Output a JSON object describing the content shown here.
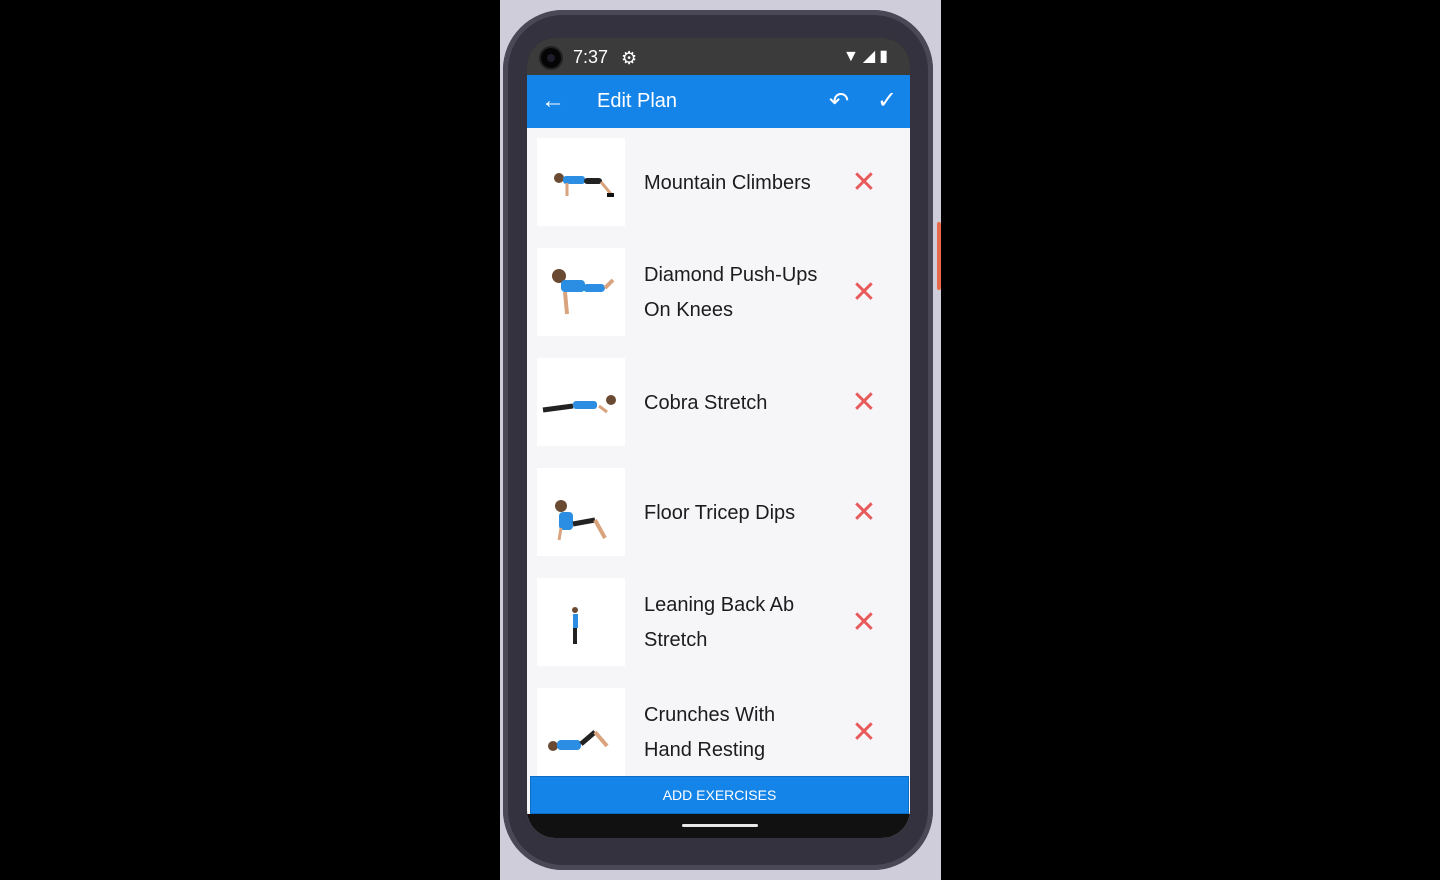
{
  "status_bar": {
    "time": "7:37",
    "settings_icon": "gear-icon",
    "wifi_icon": "wifi-icon",
    "signal_icon": "signal-icon",
    "battery_icon": "battery-icon"
  },
  "app_bar": {
    "title": "Edit Plan",
    "back_icon": "arrow-left-icon",
    "undo_icon": "undo-icon",
    "save_icon": "check-icon",
    "background_color": "#1584e8"
  },
  "exercises": [
    {
      "name_line1": "Mountain Climbers",
      "name_line2": ""
    },
    {
      "name_line1": "Diamond Push-Ups",
      "name_line2": "On Knees"
    },
    {
      "name_line1": "Cobra Stretch",
      "name_line2": ""
    },
    {
      "name_line1": "Floor Tricep Dips",
      "name_line2": ""
    },
    {
      "name_line1": "Leaning Back Ab",
      "name_line2": "Stretch"
    },
    {
      "name_line1": "Crunches With",
      "name_line2": "Hand Resting"
    }
  ],
  "remove_icon": "close-icon",
  "remove_color": "#e85a5a",
  "add_exercises_label": "ADD EXERCISES"
}
